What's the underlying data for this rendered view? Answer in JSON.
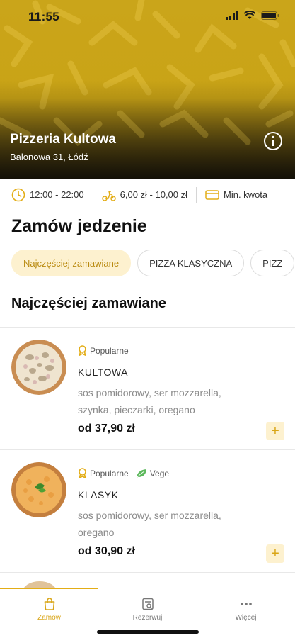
{
  "status_bar": {
    "time": "11:55"
  },
  "restaurant": {
    "name": "Pizzeria Kultowa",
    "address": "Balonowa 31, Łódź"
  },
  "info": {
    "hours": "12:00 - 22:00",
    "delivery": "6,00 zł - 10,00 zł",
    "min_order": "Min. kwota"
  },
  "page": {
    "title": "Zamów jedzenie"
  },
  "chips": [
    {
      "label": "Najczęściej zamawiane",
      "active": true
    },
    {
      "label": "PIZZA KLASYCZNA",
      "active": false
    },
    {
      "label": "PIZZ",
      "active": false
    }
  ],
  "category": {
    "title": "Najczęściej zamawiane"
  },
  "products": [
    {
      "badge_popular": "Popularne",
      "badge_vege": "",
      "name": "KULTOWA",
      "desc": "sos pomidorowy, ser mozzarella, szynka, pieczarki, oregano",
      "price": "od 37,90 zł",
      "add_label": "+"
    },
    {
      "badge_popular": "Popularne",
      "badge_vege": "Vege",
      "name": "KLASYK",
      "desc": "sos pomidorowy, ser mozzarella, oregano",
      "price": "od 30,90 zł",
      "add_label": "+"
    }
  ],
  "tabs": [
    {
      "label": "Zamów",
      "icon": "bag-icon",
      "active": true
    },
    {
      "label": "Rezerwuj",
      "icon": "reservation-icon",
      "active": false
    },
    {
      "label": "Więcej",
      "icon": "more-icon",
      "active": false
    }
  ],
  "colors": {
    "accent": "#e3ad16",
    "accent_light": "#fdf1cf",
    "vege": "#5cb85c"
  }
}
